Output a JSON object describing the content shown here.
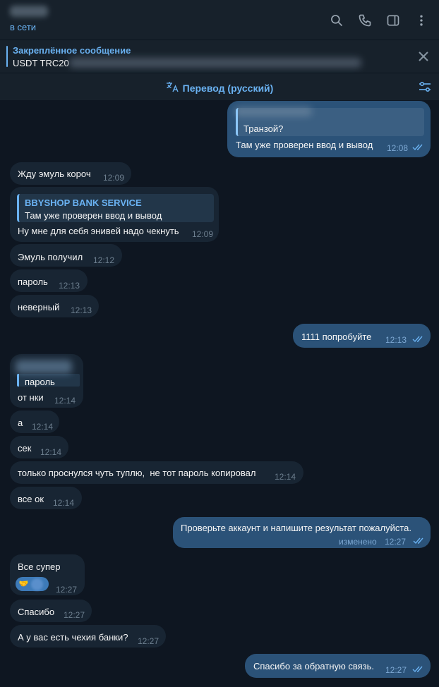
{
  "header": {
    "status": "в сети",
    "icons": [
      "search-icon",
      "phone-icon",
      "sidebar-icon",
      "more-icon"
    ]
  },
  "pinned": {
    "title": "Закреплённое сообщение",
    "text": "USDT TRC20"
  },
  "translate": {
    "label": "Перевод (русский)"
  },
  "messages": [
    {
      "dir": "out",
      "reply_text": "Транзой?",
      "text": "Там уже проверен ввод и вывод",
      "time": "12:08"
    },
    {
      "dir": "in",
      "text": "Жду эмуль короч",
      "time": "12:09"
    },
    {
      "dir": "in",
      "reply_name": "BBYSHOP BANK SERVICE",
      "reply_text": "Там уже проверен ввод и вывод",
      "text": "Ну мне для себя энивей надо чекнуть",
      "time": "12:09"
    },
    {
      "dir": "in",
      "text": "Эмуль получил",
      "time": "12:12"
    },
    {
      "dir": "in",
      "text": "пароль",
      "time": "12:13"
    },
    {
      "dir": "in",
      "text": "неверный",
      "time": "12:13"
    },
    {
      "dir": "out",
      "text": "1111 попробуйте",
      "time": "12:13"
    },
    {
      "dir": "in",
      "reply_text": "пароль",
      "text": "от нки",
      "time": "12:14"
    },
    {
      "dir": "in",
      "text": "а",
      "time": "12:14"
    },
    {
      "dir": "in",
      "text": "сек",
      "time": "12:14"
    },
    {
      "dir": "in",
      "text": "только проснулся чуть туплю,  не тот пароль копировал",
      "time": "12:14"
    },
    {
      "dir": "in",
      "text": "все ок",
      "time": "12:14"
    },
    {
      "dir": "out",
      "text": "Проверьте аккаунт и напишите результат пожалуйста.",
      "edited": "изменено",
      "time": "12:27"
    },
    {
      "dir": "in",
      "text": "Все супер",
      "reaction": "🤝",
      "time": "12:27"
    },
    {
      "dir": "in",
      "text": "Спасибо",
      "time": "12:27"
    },
    {
      "dir": "in",
      "text": "А у вас есть чехия банки?",
      "time": "12:27"
    },
    {
      "dir": "out",
      "text": "Спасибо за обратную связь.",
      "time": "12:27"
    }
  ]
}
